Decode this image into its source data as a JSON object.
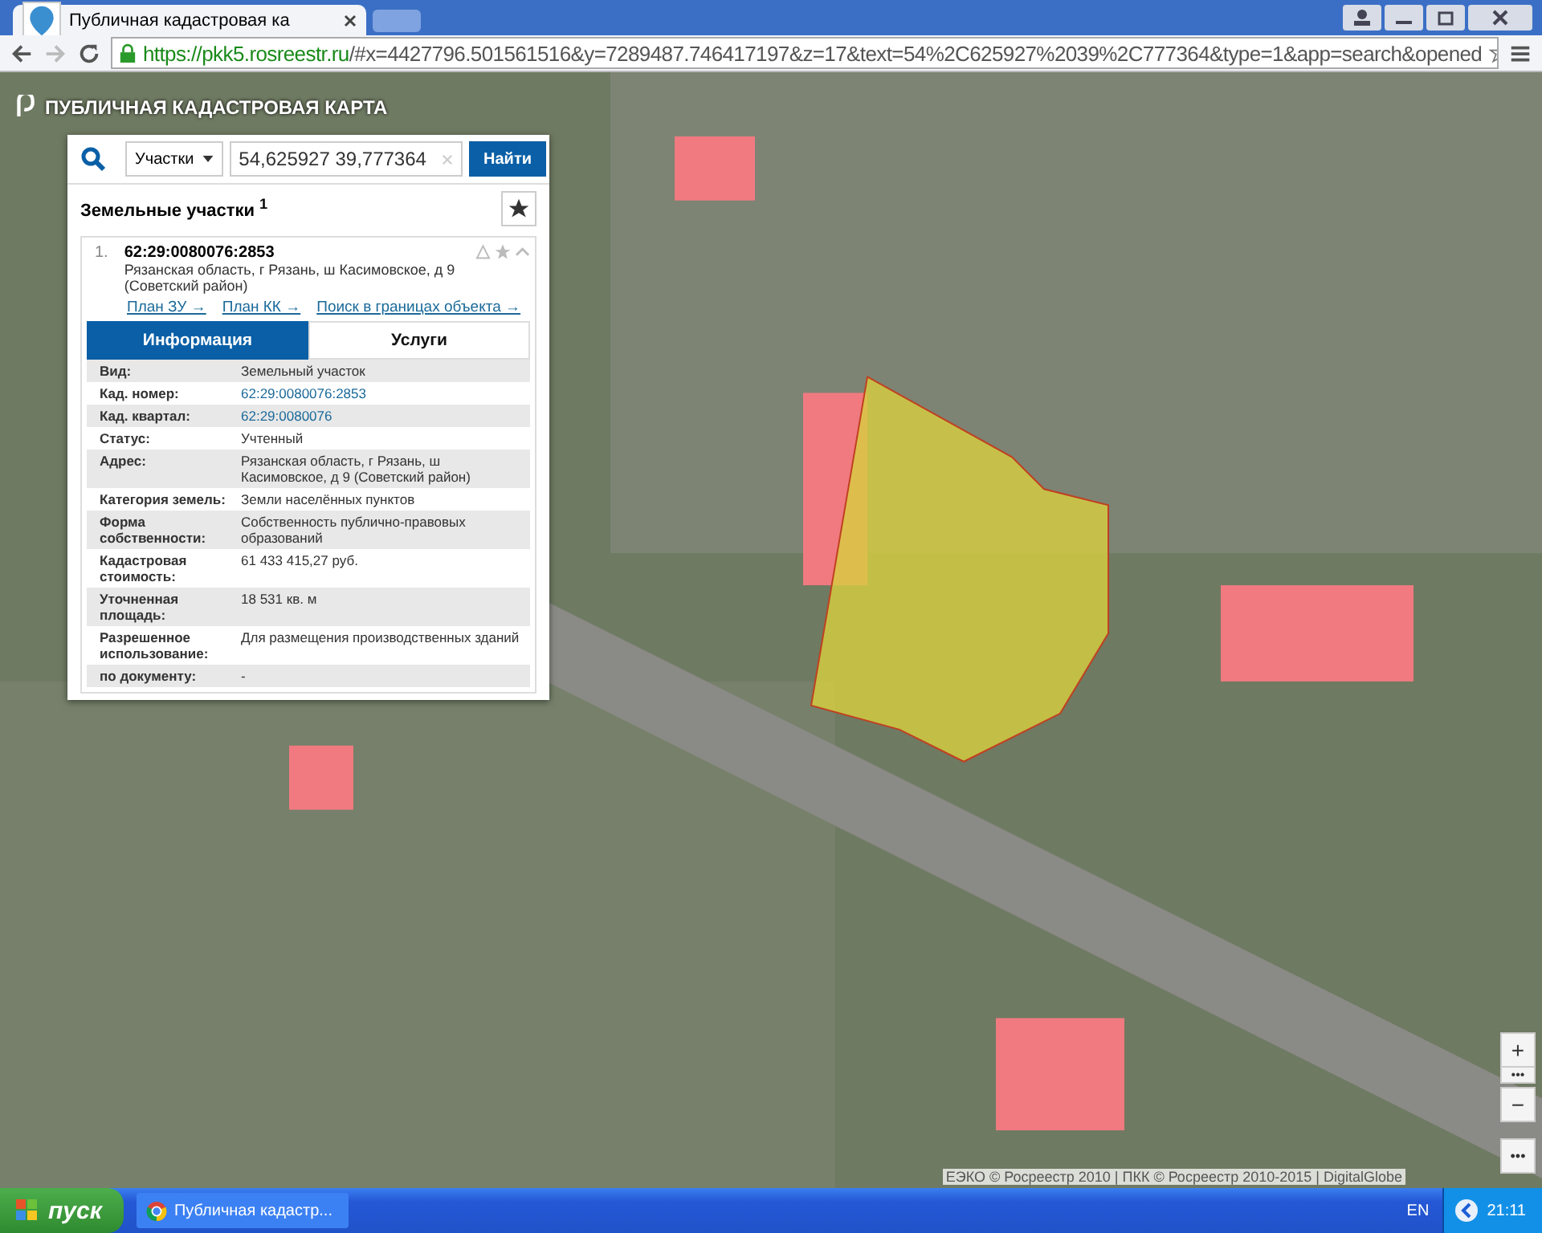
{
  "browser": {
    "tab_title": "Публичная кадастровая ка",
    "url_host": "https://pkk5.rosreestr.ru",
    "url_rest": "/#x=4427796.501561516&y=7289487.746417197&z=17&text=54%2C625927%2039%2C777364&type=1&app=search&opened"
  },
  "app": {
    "logo_text": "ПУБЛИЧНАЯ КАДАСТРОВАЯ КАРТА"
  },
  "search": {
    "type_label": "Участки",
    "value": "54,625927 39,777364",
    "button": "Найти"
  },
  "results": {
    "heading": "Земельные участки",
    "count": "1",
    "item": {
      "number": "1.",
      "cad_number": "62:29:0080076:2853",
      "address": "Рязанская область, г Рязань, ш Касимовское, д 9 (Советский район)",
      "links": [
        "План ЗУ →",
        "План КК →",
        "Поиск в границах объекта →"
      ],
      "tabs": [
        {
          "label": "Информация",
          "selected": true
        },
        {
          "label": "Услуги",
          "selected": false
        }
      ],
      "fields": [
        {
          "label": "Вид:",
          "value": "Земельный участок",
          "kind": "text"
        },
        {
          "label": "Кад. номер:",
          "value": "62:29:0080076:2853",
          "kind": "link"
        },
        {
          "label": "Кад. квартал:",
          "value": "62:29:0080076",
          "kind": "link"
        },
        {
          "label": "Статус:",
          "value": "Учтенный",
          "kind": "text"
        },
        {
          "label": "Адрес:",
          "value": "Рязанская область, г Рязань, ш Касимовское, д 9 (Советский район)",
          "kind": "text"
        },
        {
          "label": "Категория земель:",
          "value": "Земли населённых пунктов",
          "kind": "text"
        },
        {
          "label": "Форма собственности:",
          "value": "Собственность публично-правовых образований",
          "kind": "text"
        },
        {
          "label": "Кадастровая стоимость:",
          "value": "61 433 415,27 руб.",
          "kind": "text"
        },
        {
          "label": "Уточненная площадь:",
          "value": "18 531 кв. м",
          "kind": "text"
        },
        {
          "label": "Разрешенное использование:",
          "value": "Для размещения производственных зданий",
          "kind": "text"
        },
        {
          "label": "по документу:",
          "value": "-",
          "kind": "text"
        }
      ]
    }
  },
  "map_controls": [
    "+",
    "•••",
    "−",
    "•••"
  ],
  "attribution": "ЕЭКО © Росреестр 2010 | ПКК © Росреестр 2010-2015 | DigitalGlobe",
  "taskbar": {
    "start": "пуск",
    "task": "Публичная кадастр...",
    "lang": "EN",
    "clock": "21:11"
  }
}
